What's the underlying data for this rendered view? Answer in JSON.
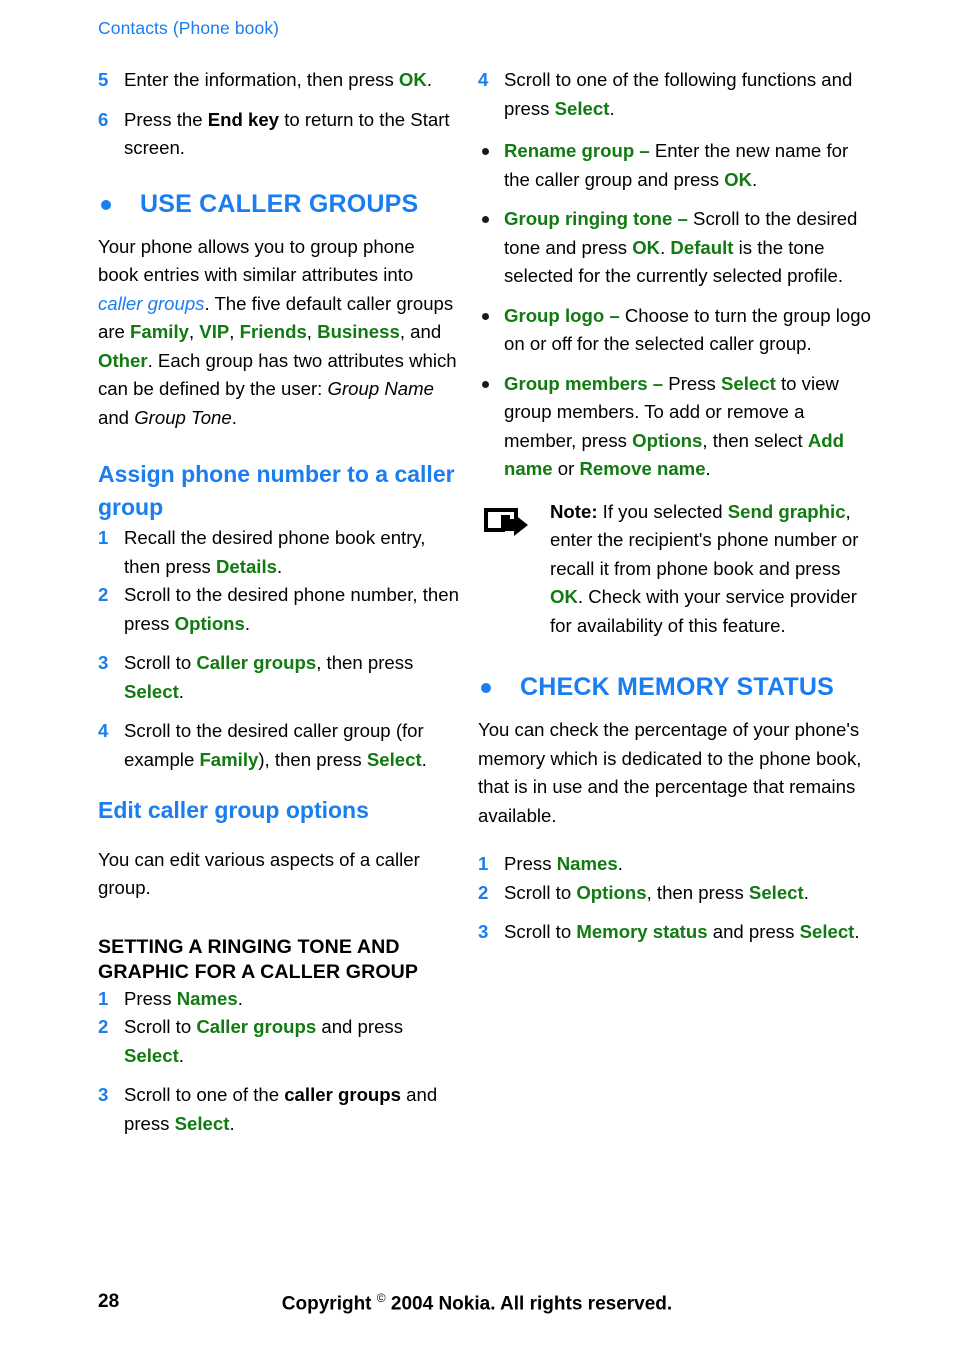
{
  "colors": {
    "blue": "#1a7ef0",
    "green": "#117a11",
    "black": "#000000"
  },
  "running_header": "Contacts (Phone book)",
  "left_column": {
    "continued_steps": [
      {
        "num": "5",
        "parts": [
          {
            "t": "Enter the information, then press ",
            "s": "plain"
          },
          {
            "t": "OK",
            "s": "green"
          },
          {
            "t": ".",
            "s": "plain"
          }
        ]
      },
      {
        "num": "6",
        "parts": [
          {
            "t": "Press the ",
            "s": "plain"
          },
          {
            "t": "End key",
            "s": "bold"
          },
          {
            "t": " to return to the Start screen.",
            "s": "plain"
          }
        ]
      }
    ],
    "section_heading": "USE CALLER GROUPS",
    "intro_paragraph": [
      {
        "t": "Your phone allows you to group phone book entries with similar attributes into ",
        "s": "plain"
      },
      {
        "t": "caller groups",
        "s": "blue-italic"
      },
      {
        "t": ". The five default caller groups are ",
        "s": "plain"
      },
      {
        "t": "Family",
        "s": "green"
      },
      {
        "t": ", ",
        "s": "plain"
      },
      {
        "t": "VIP",
        "s": "green"
      },
      {
        "t": ", ",
        "s": "plain"
      },
      {
        "t": "Friends",
        "s": "green"
      },
      {
        "t": ", ",
        "s": "plain"
      },
      {
        "t": "Business",
        "s": "green"
      },
      {
        "t": ", and ",
        "s": "plain"
      },
      {
        "t": "Other",
        "s": "green"
      },
      {
        "t": ". Each group has two attributes which can be defined by the user: ",
        "s": "plain"
      },
      {
        "t": "Group Name",
        "s": "italic"
      },
      {
        "t": " and ",
        "s": "plain"
      },
      {
        "t": "Group Tone",
        "s": "italic"
      },
      {
        "t": ".",
        "s": "plain"
      }
    ],
    "assign_heading": "Assign phone number to a caller group",
    "assign_steps": [
      {
        "num": "1",
        "parts": [
          {
            "t": "Recall the desired phone book entry, then press ",
            "s": "plain"
          },
          {
            "t": "Details",
            "s": "green"
          },
          {
            "t": ".",
            "s": "plain"
          }
        ]
      },
      {
        "num": "2",
        "parts": [
          {
            "t": "Scroll to the desired phone number, then press ",
            "s": "plain"
          },
          {
            "t": "Options",
            "s": "green"
          },
          {
            "t": ".",
            "s": "plain"
          }
        ]
      },
      {
        "num": "3",
        "parts": [
          {
            "t": "Scroll to ",
            "s": "plain"
          },
          {
            "t": "Caller groups",
            "s": "green"
          },
          {
            "t": ", then press ",
            "s": "plain"
          },
          {
            "t": "Select",
            "s": "green"
          },
          {
            "t": ".",
            "s": "plain"
          }
        ]
      },
      {
        "num": "4",
        "parts": [
          {
            "t": "Scroll to the desired caller group (for example ",
            "s": "plain"
          },
          {
            "t": "Family",
            "s": "green"
          },
          {
            "t": "), then press ",
            "s": "plain"
          },
          {
            "t": "Select",
            "s": "green"
          },
          {
            "t": ".",
            "s": "plain"
          }
        ]
      }
    ],
    "edit_heading": "Edit caller group options",
    "edit_paragraph": [
      {
        "t": "You can edit various aspects of a caller group.",
        "s": "plain"
      }
    ],
    "ringing_heading": "SETTING A RINGING TONE AND GRAPHIC FOR A CALLER GROUP",
    "ringing_steps": [
      {
        "num": "1",
        "parts": [
          {
            "t": "Press ",
            "s": "plain"
          },
          {
            "t": "Names",
            "s": "green"
          },
          {
            "t": ".",
            "s": "plain"
          }
        ]
      },
      {
        "num": "2",
        "parts": [
          {
            "t": "Scroll to ",
            "s": "plain"
          },
          {
            "t": "Caller groups",
            "s": "green"
          },
          {
            "t": " and press ",
            "s": "plain"
          },
          {
            "t": "Select",
            "s": "green"
          },
          {
            "t": ".",
            "s": "plain"
          }
        ]
      },
      {
        "num": "3",
        "parts": [
          {
            "t": "Scroll to one of the ",
            "s": "plain"
          },
          {
            "t": "caller groups",
            "s": "bold"
          },
          {
            "t": " and press ",
            "s": "plain"
          },
          {
            "t": "Select",
            "s": "green"
          },
          {
            "t": ".",
            "s": "plain"
          }
        ]
      }
    ]
  },
  "right_column": {
    "step4": {
      "num": "4",
      "parts": [
        {
          "t": "Scroll to one of the following functions and press ",
          "s": "plain"
        },
        {
          "t": "Select",
          "s": "green"
        },
        {
          "t": ".",
          "s": "plain"
        }
      ]
    },
    "function_bullets": [
      [
        {
          "t": "Rename group",
          "s": "green"
        },
        {
          "t": " ",
          "s": "plain"
        },
        {
          "t": "–",
          "s": "green"
        },
        {
          "t": " Enter the new name for the caller group and press ",
          "s": "plain"
        },
        {
          "t": "OK",
          "s": "green"
        },
        {
          "t": ".",
          "s": "plain"
        }
      ],
      [
        {
          "t": "Group ringing tone",
          "s": "green"
        },
        {
          "t": " ",
          "s": "plain"
        },
        {
          "t": "–",
          "s": "green"
        },
        {
          "t": " Scroll to the desired tone and press ",
          "s": "plain"
        },
        {
          "t": "OK",
          "s": "green"
        },
        {
          "t": ". ",
          "s": "plain"
        },
        {
          "t": "Default",
          "s": "green"
        },
        {
          "t": " is the tone selected for the currently selected profile.",
          "s": "plain"
        }
      ],
      [
        {
          "t": "Group logo",
          "s": "green"
        },
        {
          "t": " ",
          "s": "plain"
        },
        {
          "t": "–",
          "s": "green"
        },
        {
          "t": " Choose to turn the group logo on or off for the selected caller group.",
          "s": "plain"
        }
      ],
      [
        {
          "t": "Group members",
          "s": "green"
        },
        {
          "t": " ",
          "s": "plain"
        },
        {
          "t": "–",
          "s": "green"
        },
        {
          "t": " Press ",
          "s": "plain"
        },
        {
          "t": "Select",
          "s": "green"
        },
        {
          "t": " to view group members. To add or remove a member, press ",
          "s": "plain"
        },
        {
          "t": "Options",
          "s": "green"
        },
        {
          "t": ", then select ",
          "s": "plain"
        },
        {
          "t": "Add name",
          "s": "green"
        },
        {
          "t": " or ",
          "s": "plain"
        },
        {
          "t": "Remove name",
          "s": "green"
        },
        {
          "t": ".",
          "s": "plain"
        }
      ]
    ],
    "note": {
      "icon": "note-arrow-icon",
      "parts": [
        {
          "t": "Note:",
          "s": "bold"
        },
        {
          "t": " If you selected ",
          "s": "plain"
        },
        {
          "t": "Send graphic",
          "s": "green"
        },
        {
          "t": ", enter the recipient's phone number or recall it from phone book and press ",
          "s": "plain"
        },
        {
          "t": "OK",
          "s": "green"
        },
        {
          "t": ". Check with your service provider for availability of this feature.",
          "s": "plain"
        }
      ]
    },
    "memory_heading": "CHECK MEMORY STATUS",
    "memory_paragraph": [
      {
        "t": "You can check the percentage of your phone's memory which is dedicated to the phone book, that is in use and the percentage that remains available.",
        "s": "plain"
      }
    ],
    "memory_steps": [
      {
        "num": "1",
        "parts": [
          {
            "t": "Press ",
            "s": "plain"
          },
          {
            "t": "Names",
            "s": "green"
          },
          {
            "t": ".",
            "s": "plain"
          }
        ]
      },
      {
        "num": "2",
        "parts": [
          {
            "t": "Scroll to ",
            "s": "plain"
          },
          {
            "t": "Options",
            "s": "green"
          },
          {
            "t": ", then press ",
            "s": "plain"
          },
          {
            "t": "Select",
            "s": "green"
          },
          {
            "t": ".",
            "s": "plain"
          }
        ]
      },
      {
        "num": "3",
        "parts": [
          {
            "t": "Scroll to ",
            "s": "plain"
          },
          {
            "t": "Memory status",
            "s": "green"
          },
          {
            "t": " and press ",
            "s": "plain"
          },
          {
            "t": "Select",
            "s": "green"
          },
          {
            "t": ".",
            "s": "plain"
          }
        ]
      }
    ]
  },
  "footer": {
    "page_number": "28",
    "copyright_pre": "Copyright ",
    "copyright_sym": "©",
    "copyright_post": " 2004 Nokia. All rights reserved."
  }
}
